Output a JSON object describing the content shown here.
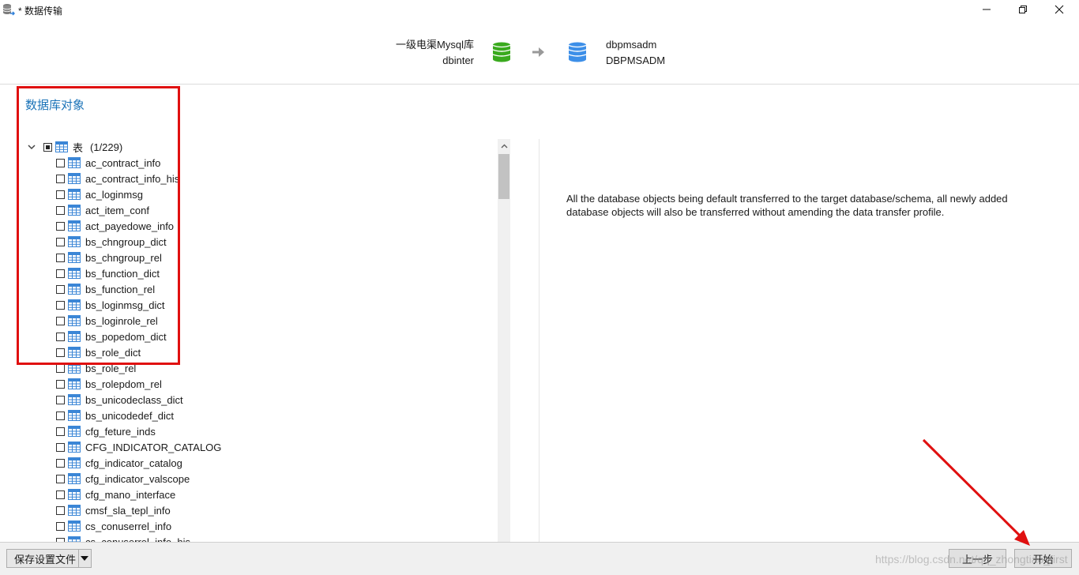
{
  "window": {
    "title": "* 数据传输"
  },
  "header": {
    "source": {
      "connection": "一级电渠Mysql库",
      "database": "dbinter",
      "color": "#3aaa1e"
    },
    "target": {
      "connection": "dbpmsadm",
      "database": "DBPMSADM",
      "color": "#3d8fe8"
    }
  },
  "section_title": "数据库对象",
  "tree": {
    "root": {
      "label": "表",
      "count": "(1/229)",
      "expanded": true,
      "check_state": "partial"
    },
    "items": [
      "ac_contract_info",
      "ac_contract_info_his",
      "ac_loginmsg",
      "act_item_conf",
      "act_payedowe_info",
      "bs_chngroup_dict",
      "bs_chngroup_rel",
      "bs_function_dict",
      "bs_function_rel",
      "bs_loginmsg_dict",
      "bs_loginrole_rel",
      "bs_popedom_dict",
      "bs_role_dict",
      "bs_role_rel",
      "bs_rolepdom_rel",
      "bs_unicodeclass_dict",
      "bs_unicodedef_dict",
      "cfg_feture_inds",
      "CFG_INDICATOR_CATALOG",
      "cfg_indicator_catalog",
      "cfg_indicator_valscope",
      "cfg_mano_interface",
      "cmsf_sla_tepl_info",
      "cs_conuserrel_info",
      "cs_conuserrel_info_his"
    ]
  },
  "description": "All the database objects being default transferred to the target database/schema, all newly added database objects will also be transferred without amending the data transfer profile.",
  "footer": {
    "save_label": "保存设置文件",
    "prev_label": "上一步",
    "start_label": "开始"
  },
  "watermark": "https://blog.csdn.net/qq_zhongtiao_first",
  "annotation_color": "#e01010"
}
